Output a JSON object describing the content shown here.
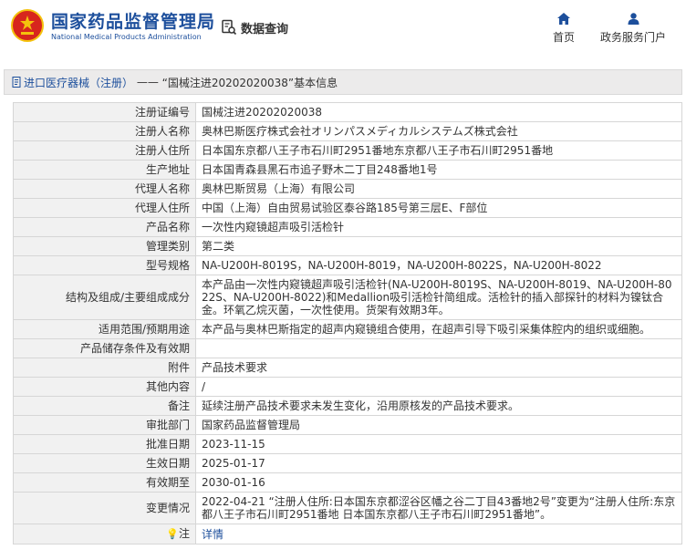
{
  "header": {
    "logo_cn": "国家药品监督管理局",
    "logo_en": "National Medical Products Administration",
    "search_label": "数据查询",
    "nav": [
      {
        "label": "首页",
        "icon": "home-icon"
      },
      {
        "label": "政务服务门户",
        "icon": "person-icon"
      }
    ]
  },
  "title_bar": {
    "crumb": "进口医疗器械（注册）",
    "separator": " —— ",
    "title": "“国械注进20202020038”基本信息"
  },
  "rows": [
    {
      "label": "注册证编号",
      "value": "国械注进20202020038"
    },
    {
      "label": "注册人名称",
      "value": "奥林巴斯医疗株式会社オリンパスメディカルシステムズ株式会社"
    },
    {
      "label": "注册人住所",
      "value": "日本国东京都八王子市石川町2951番地东京都八王子市石川町2951番地"
    },
    {
      "label": "生产地址",
      "value": "日本国青森县黑石市追子野木二丁目248番地1号"
    },
    {
      "label": "代理人名称",
      "value": "奥林巴斯贸易（上海）有限公司"
    },
    {
      "label": "代理人住所",
      "value": "中国（上海）自由贸易试验区泰谷路185号第三层E、F部位"
    },
    {
      "label": "产品名称",
      "value": "一次性内窥镜超声吸引活检针"
    },
    {
      "label": "管理类别",
      "value": "第二类"
    },
    {
      "label": "型号规格",
      "value": "NA-U200H-8019S，NA-U200H-8019，NA-U200H-8022S，NA-U200H-8022"
    },
    {
      "label": "结构及组成/主要组成成分",
      "value": "本产品由一次性内窥镜超声吸引活检针(NA-U200H-8019S、NA-U200H-8019、NA-U200H-8022S、NA-U200H-8022)和Medallion吸引活检针简组成。活检针的插入部探针的材料为镍钛合金。环氧乙烷灭菌，一次性使用。货架有效期3年。"
    },
    {
      "label": "适用范围/预期用途",
      "value": "本产品与奥林巴斯指定的超声内窥镜组合使用，在超声引导下吸引采集体腔内的组织或细胞。"
    },
    {
      "label": "产品储存条件及有效期",
      "value": ""
    },
    {
      "label": "附件",
      "value": "产品技术要求"
    },
    {
      "label": "其他内容",
      "value": "/"
    },
    {
      "label": "备注",
      "value": "延续注册产品技术要求未发生变化，沿用原核发的产品技术要求。"
    },
    {
      "label": "审批部门",
      "value": "国家药品监督管理局"
    },
    {
      "label": "批准日期",
      "value": "2023-11-15"
    },
    {
      "label": "生效日期",
      "value": "2025-01-17"
    },
    {
      "label": "有效期至",
      "value": "2030-01-16"
    },
    {
      "label": "变更情况",
      "value": "2022-04-21 “注册人住所:日本国东京都涩谷区幡之谷二丁目43番地2号”变更为“注册人住所:东京都八王子市石川町2951番地 日本国东京都八王子市石川町2951番地”。"
    }
  ],
  "note_row": {
    "label": "注",
    "value": "详情"
  },
  "colors": {
    "brand_blue": "#1d4f9c",
    "emblem_red": "#d7261d",
    "emblem_gold": "#f4c20d"
  }
}
